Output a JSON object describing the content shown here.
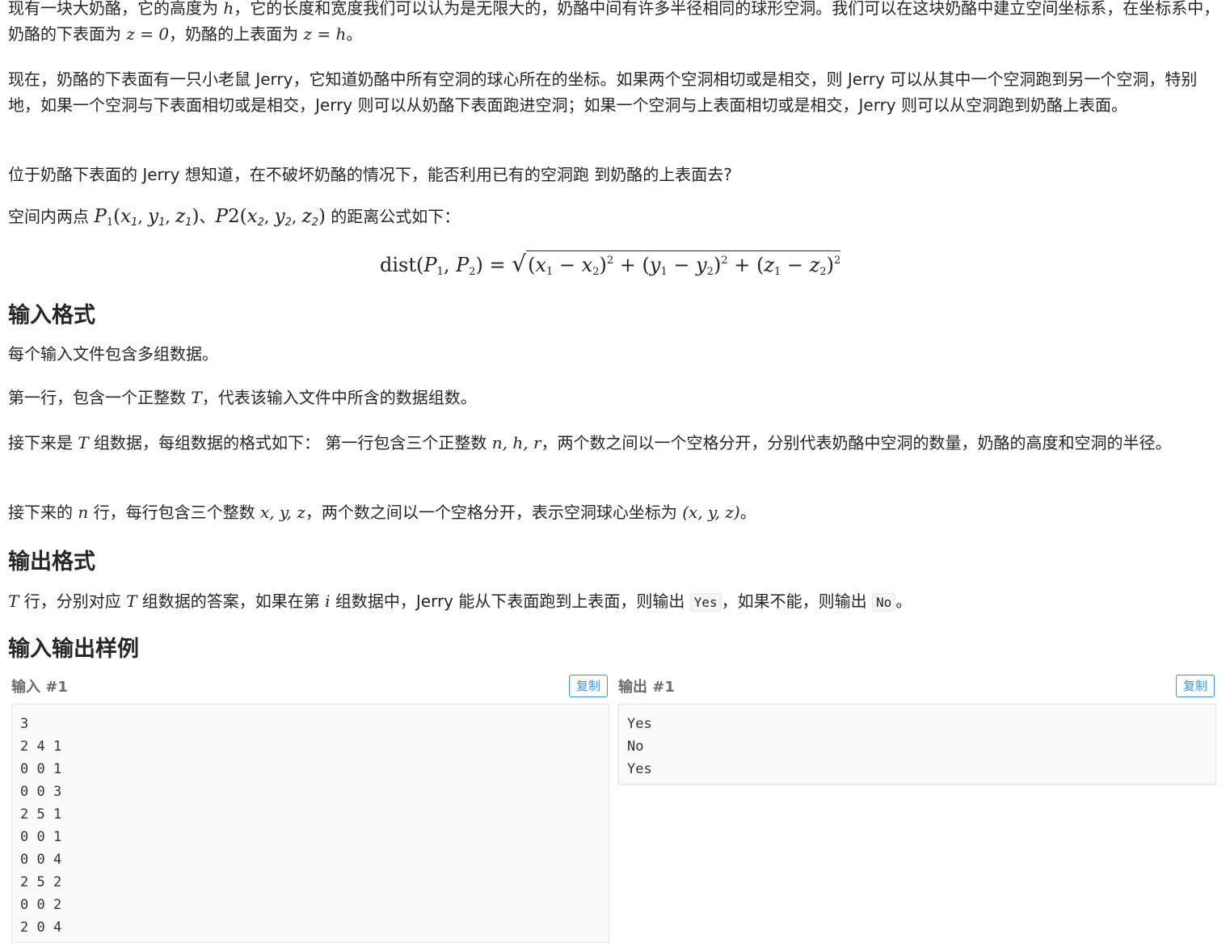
{
  "problem": {
    "para1": {
      "t1": "现有一块大奶酪，它的高度为 ",
      "m1": "h",
      "t2": "，它的长度和宽度我们可以认为是无限大的，奶酪中间有许多半径相同的球形空洞。我们可以在这块奶酪中建立空间坐标系，在坐标系中，奶酪的下表面为 ",
      "m2": "z = 0",
      "t3": "，奶酪的上表面为 ",
      "m3": "z = h",
      "t4": "。"
    },
    "para2": "现在，奶酪的下表面有一只小老鼠 Jerry，它知道奶酪中所有空洞的球心所在的坐标。如果两个空洞相切或是相交，则 Jerry 可以从其中一个空洞跑到另一个空洞，特别地，如果一个空洞与下表面相切或是相交，Jerry 则可以从奶酪下表面跑进空洞；如果一个空洞与上表面相切或是相交，Jerry 则可以从空洞跑到奶酪上表面。",
    "para3": "位于奶酪下表面的 Jerry 想知道，在不破坏奶酪的情况下，能否利用已有的空洞跑 到奶酪的上表面去?",
    "para4": {
      "t1": "空间内两点 ",
      "t2": "、",
      "t3": " 的距离公式如下："
    }
  },
  "input_format": {
    "heading": "输入格式",
    "line1": "每个输入文件包含多组数据。",
    "line2": {
      "t1": "第一行，包含一个正整数 ",
      "m1": "T",
      "t2": "，代表该输入文件中所含的数据组数。"
    },
    "line3": {
      "t1": "接下来是 ",
      "m1": "T",
      "t2": " 组数据，每组数据的格式如下： 第一行包含三个正整数 ",
      "m2": "n, h, r",
      "t3": "，两个数之间以一个空格分开，分别代表奶酪中空洞的数量，奶酪的高度和空洞的半径。"
    },
    "line4": {
      "t1": "接下来的 ",
      "m1": "n",
      "t2": " 行，每行包含三个整数 ",
      "m2": "x, y, z",
      "t3": "，两个数之间以一个空格分开，表示空洞球心坐标为 ",
      "m3": "(x, y, z)",
      "t4": "。"
    }
  },
  "output_format": {
    "heading": "输出格式",
    "line1": {
      "m1": "T",
      "t1": " 行，分别对应 ",
      "m2": "T",
      "t2": " 组数据的答案，如果在第 ",
      "m3": "i",
      "t3": " 组数据中，Jerry 能从下表面跑到上表面，则输出 ",
      "c1": "Yes",
      "t4": "，如果不能，则输出 ",
      "c2": "No",
      "t5": "。"
    }
  },
  "samples": {
    "heading": "输入输出样例",
    "input_label": "输入 #1",
    "output_label": "输出 #1",
    "copy_label": "复制",
    "input": "3\n2 4 1\n0 0 1\n0 0 3\n2 5 1\n0 0 1\n0 0 4\n2 5 2\n0 0 2\n2 0 4",
    "output": "Yes\nNo\nYes"
  }
}
